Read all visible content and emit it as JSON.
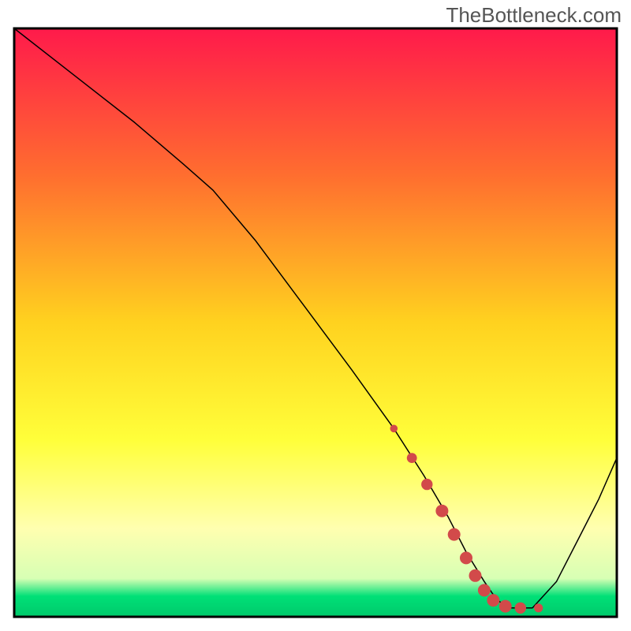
{
  "watermark": "TheBottleneck.com",
  "chart_data": {
    "type": "line",
    "title": "",
    "xlabel": "",
    "ylabel": "",
    "xlim": [
      0,
      100
    ],
    "ylim": [
      0,
      100
    ],
    "background_gradient": {
      "stops": [
        {
          "offset": 0.0,
          "color": "#ff1a4b"
        },
        {
          "offset": 0.25,
          "color": "#ff6e2f"
        },
        {
          "offset": 0.5,
          "color": "#ffd21f"
        },
        {
          "offset": 0.7,
          "color": "#ffff3a"
        },
        {
          "offset": 0.85,
          "color": "#ffffb0"
        },
        {
          "offset": 0.935,
          "color": "#d7ffb4"
        },
        {
          "offset": 0.965,
          "color": "#00e077"
        },
        {
          "offset": 1.0,
          "color": "#00c96b"
        }
      ]
    },
    "series": [
      {
        "name": "bottleneck-curve",
        "color": "#000000",
        "stroke_width": 1.5,
        "x": [
          0,
          10,
          20,
          28,
          33,
          40,
          48,
          56,
          63,
          68,
          72,
          75,
          78,
          80,
          82,
          86,
          90,
          94,
          97,
          100
        ],
        "y": [
          100,
          92,
          84,
          77,
          72.5,
          64,
          53,
          42,
          32,
          24,
          17,
          11,
          6,
          3,
          1.5,
          1.5,
          6,
          14,
          20,
          27
        ]
      }
    ],
    "highlight": {
      "name": "selected-range",
      "color": "#d24a4a",
      "points": [
        {
          "x": 63,
          "y": 32,
          "r": 3
        },
        {
          "x": 66,
          "y": 27,
          "r": 4
        },
        {
          "x": 68.5,
          "y": 22.5,
          "r": 4.5
        },
        {
          "x": 71,
          "y": 18,
          "r": 5
        },
        {
          "x": 73,
          "y": 14,
          "r": 5
        },
        {
          "x": 75,
          "y": 10,
          "r": 5
        },
        {
          "x": 76.5,
          "y": 7,
          "r": 5
        },
        {
          "x": 78,
          "y": 4.5,
          "r": 5
        },
        {
          "x": 79.5,
          "y": 2.8,
          "r": 5
        },
        {
          "x": 81.5,
          "y": 1.8,
          "r": 5
        },
        {
          "x": 84,
          "y": 1.5,
          "r": 4.5
        },
        {
          "x": 87,
          "y": 1.5,
          "r": 3.5
        }
      ]
    },
    "axes_border_color": "#000000"
  }
}
